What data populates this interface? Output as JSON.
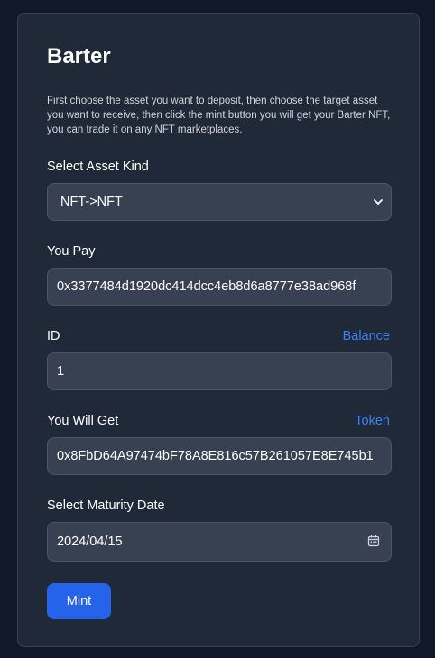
{
  "form": {
    "title": "Barter",
    "description": "First choose the asset you want to deposit, then choose the target asset you want to receive, then click the mint button you will get your Barter NFT, you can trade it on any NFT marketplaces.",
    "asset_kind": {
      "label": "Select Asset Kind",
      "value": "NFT->NFT"
    },
    "you_pay": {
      "label": "You Pay",
      "value": "0x3377484d1920dc414dcc4eb8d6a8777e38ad968f"
    },
    "id": {
      "label": "ID",
      "link": "Balance",
      "value": "1"
    },
    "you_will_get": {
      "label": "You Will Get",
      "link": "Token",
      "value": "0x8FbD64A97474bF78A8E816c57B261057E8E745b1"
    },
    "maturity_date": {
      "label": "Select Maturity Date",
      "value": "2024/04/15"
    },
    "mint_label": "Mint"
  },
  "icons": {
    "select_chevron": "chevron-down-icon",
    "date_picker": "calendar-icon"
  },
  "colors": {
    "background": "#111827",
    "card": "#1f2937",
    "field": "#374151",
    "accent": "#2563eb",
    "link": "#3b82f6"
  }
}
